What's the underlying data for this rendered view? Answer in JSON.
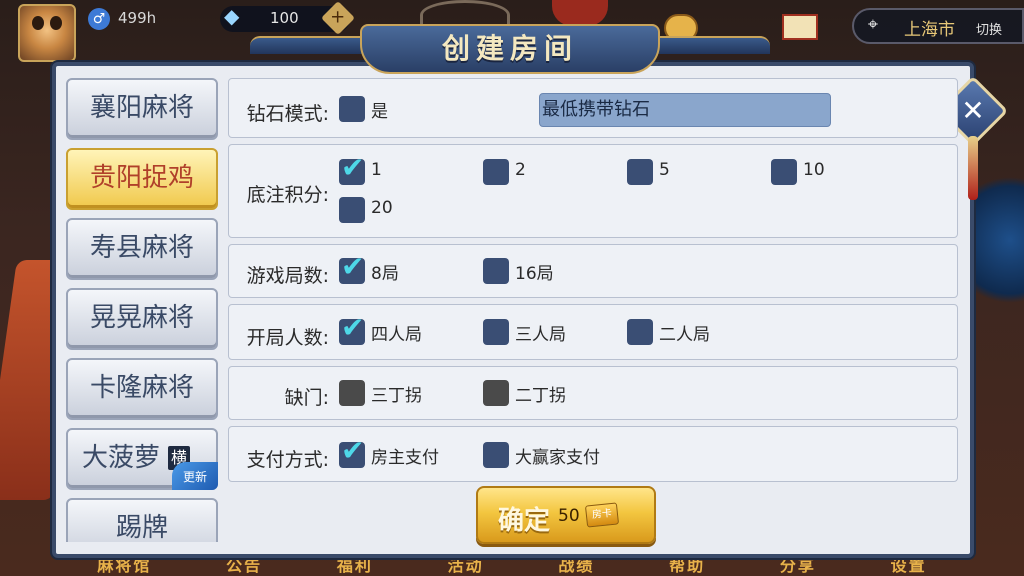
{
  "topbar": {
    "user_id": "499h",
    "diamonds": "100",
    "city": "上海市",
    "switch_label": "切换"
  },
  "dialog": {
    "title": "创建房间",
    "confirm_label": "确定",
    "confirm_cost": "50",
    "card_label": "房卡"
  },
  "games": [
    {
      "label": "襄阳麻将"
    },
    {
      "label": "贵阳捉鸡"
    },
    {
      "label": "寿县麻将"
    },
    {
      "label": "晃晃麻将"
    },
    {
      "label": "卡隆麻将"
    },
    {
      "label": "大菠萝",
      "top_badge": "横",
      "badge": "更新"
    },
    {
      "label": "踢牌"
    }
  ],
  "rows": {
    "diamond_mode": {
      "label": "钻石模式:",
      "opt": "是",
      "min_diamond": "最低携带钻石"
    },
    "base_score": {
      "label": "底注积分:",
      "options": [
        "1",
        "2",
        "5",
        "10",
        "20"
      ]
    },
    "rounds": {
      "label": "游戏局数:",
      "options": [
        "8局",
        "16局"
      ]
    },
    "players": {
      "label": "开局人数:",
      "options": [
        "四人局",
        "三人局",
        "二人局"
      ]
    },
    "missing": {
      "label": "缺门:",
      "options": [
        "三丁拐",
        "二丁拐"
      ]
    },
    "payment": {
      "label": "支付方式:",
      "options": [
        "房主支付",
        "大赢家支付"
      ]
    }
  },
  "bottom_nav": [
    "麻将馆",
    "公告",
    "福利",
    "活动",
    "战绩",
    "帮助",
    "分享",
    "设置"
  ]
}
